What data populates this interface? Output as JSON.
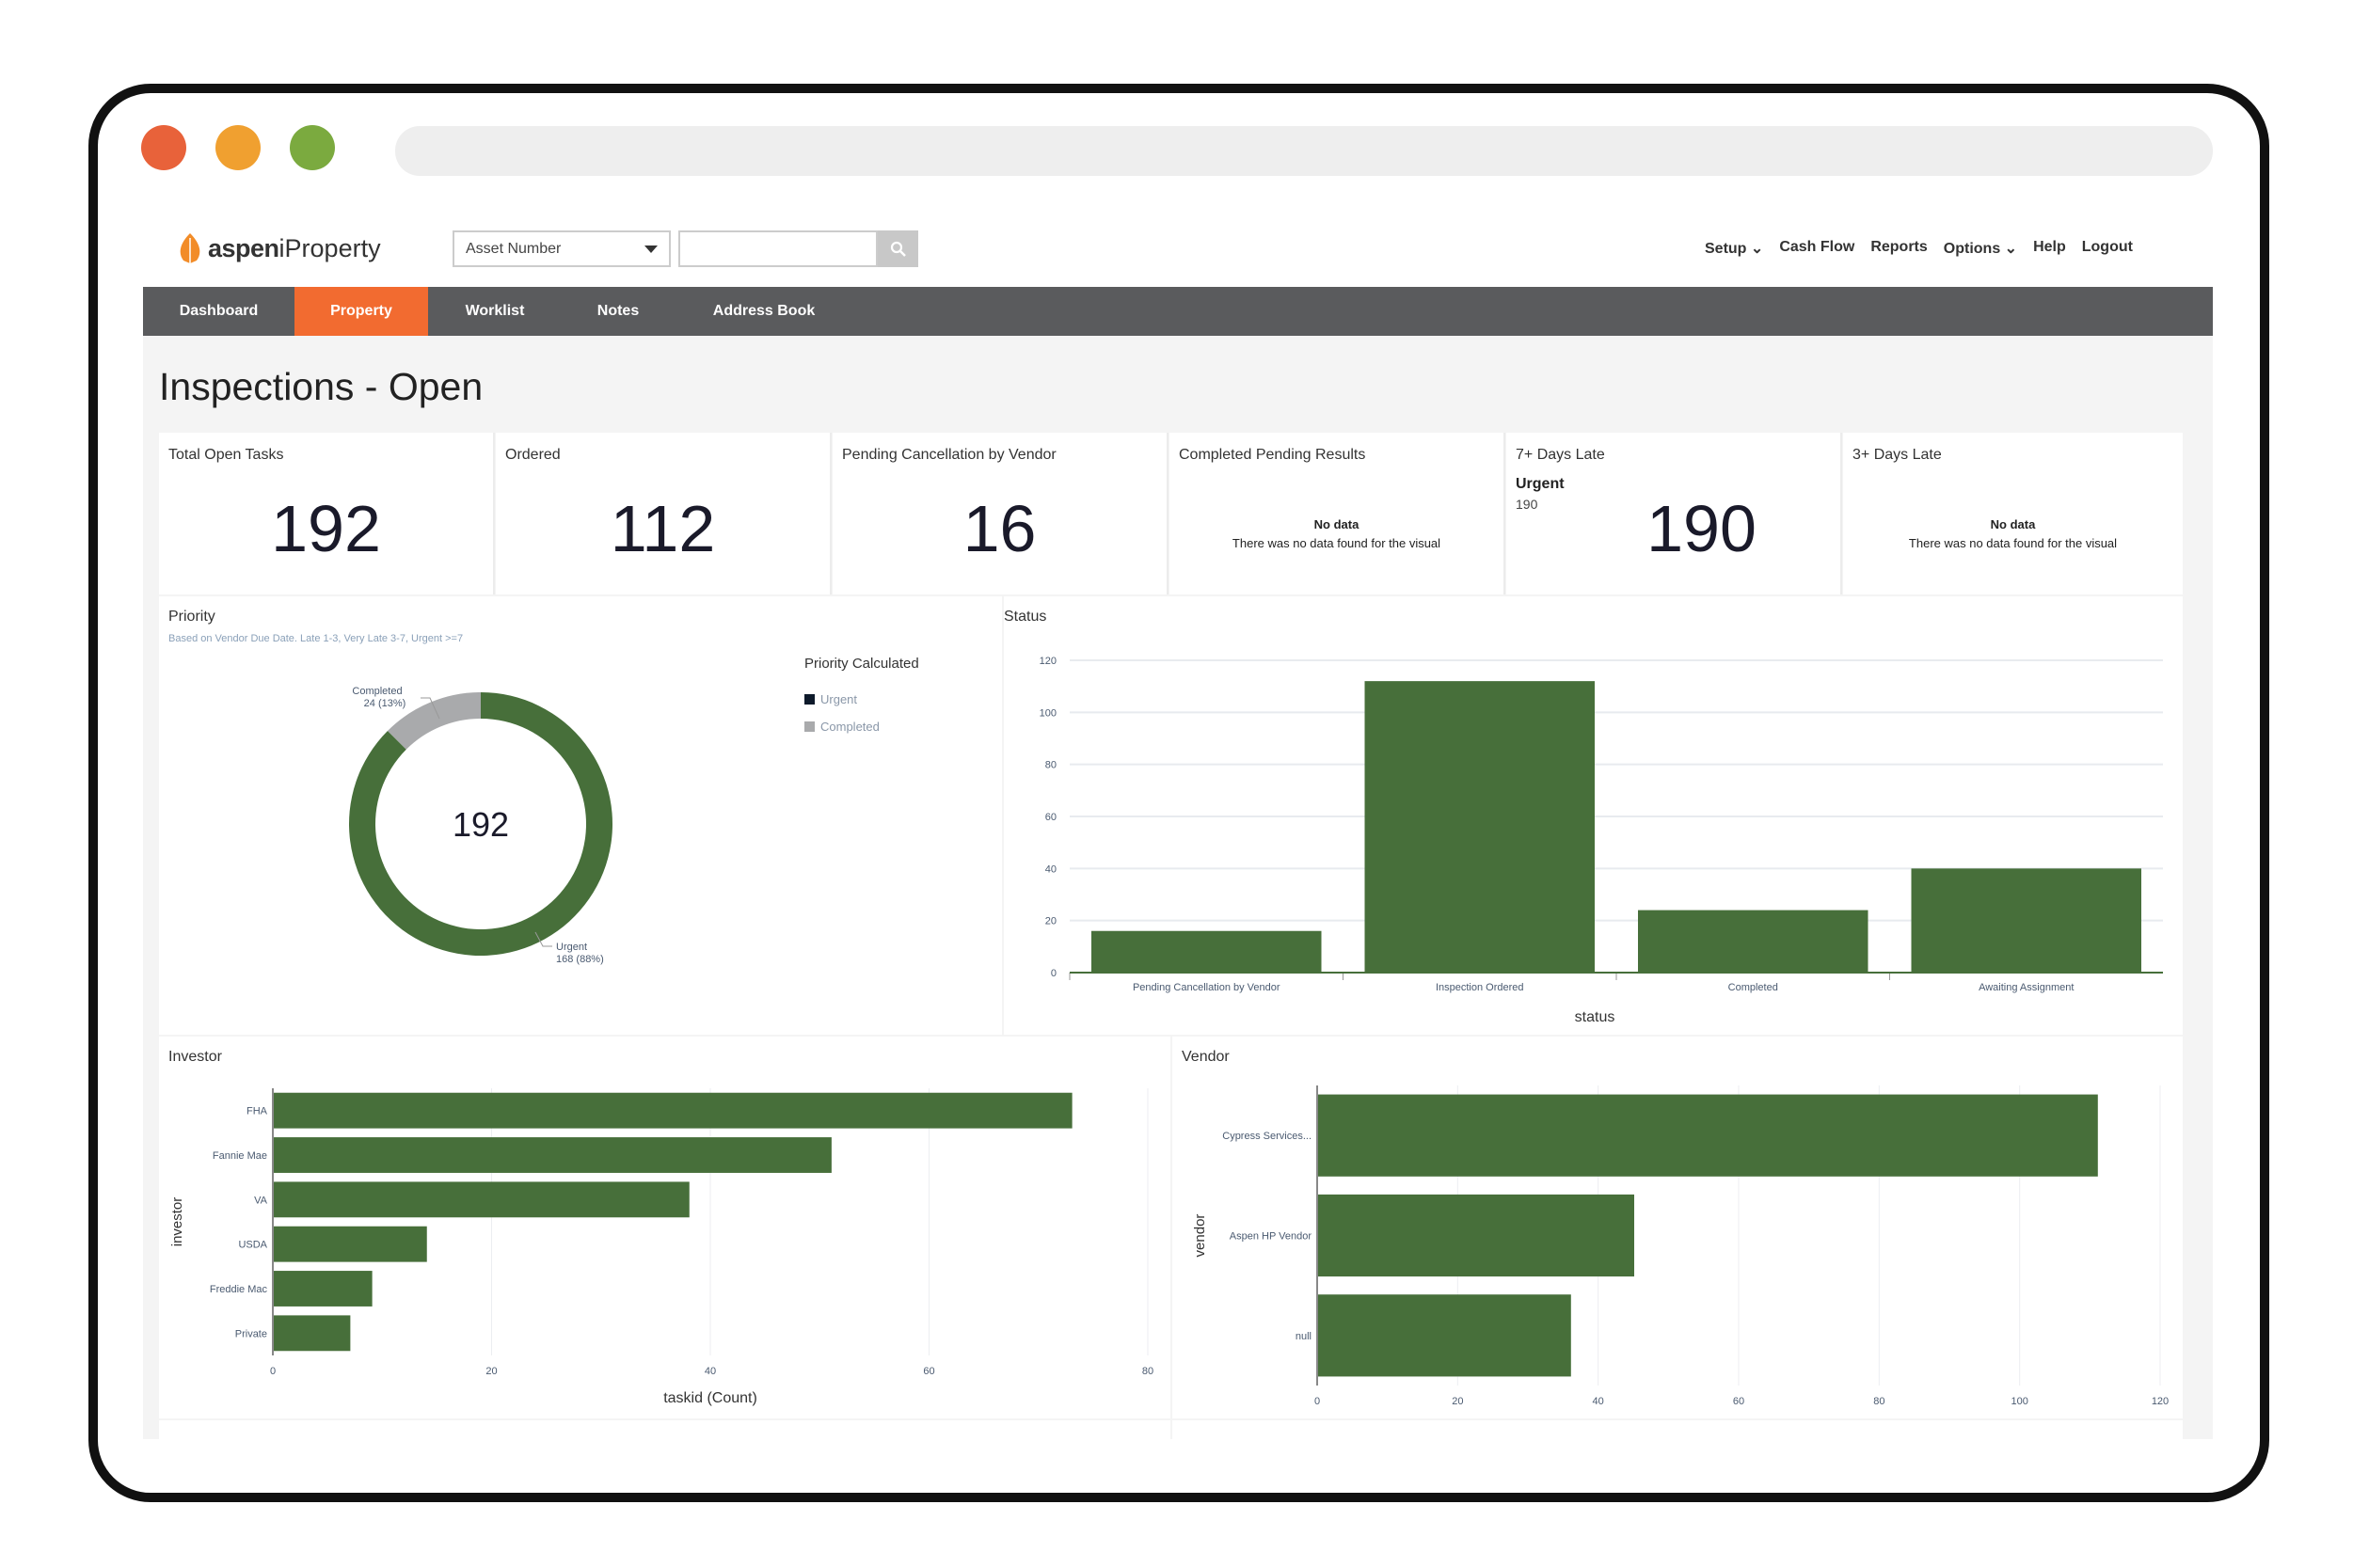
{
  "window": {
    "traffic_lights": [
      "#E8623A",
      "#F0A030",
      "#7BAA3F"
    ]
  },
  "header": {
    "logo_text_bold": "aspen",
    "logo_text": "iProperty",
    "search_select": "Asset Number",
    "search_value": "",
    "nav": [
      "Setup",
      "Cash Flow",
      "Reports",
      "Options",
      "Help",
      "Logout"
    ]
  },
  "navbar": {
    "tabs": [
      "Dashboard",
      "Property",
      "Worklist",
      "Notes",
      "Address Book"
    ],
    "active": "Property"
  },
  "page": {
    "title": "Inspections - Open"
  },
  "kpis": [
    {
      "label": "Total Open Tasks",
      "value": "192"
    },
    {
      "label": "Ordered",
      "value": "112"
    },
    {
      "label": "Pending Cancellation by Vendor",
      "value": "16"
    },
    {
      "label": "Completed Pending Results",
      "no_data": "No data",
      "no_data_msg": "There was no data found for the visual"
    },
    {
      "label": "7+ Days Late",
      "sub_label": "Urgent",
      "sub_value": "190",
      "value": "190"
    },
    {
      "label": "3+ Days Late",
      "no_data": "No data",
      "no_data_msg": "There was no data found for the visual"
    }
  ],
  "colors": {
    "bar": "#476F3A",
    "completed": "#A9AAAC",
    "accent": "#F26B30",
    "nav": "#5A5B5D"
  },
  "chart_data": [
    {
      "type": "pie",
      "title": "Priority",
      "subtitle": "Based on Vendor Due Date. Late 1-3, Very Late 3-7, Urgent >=7",
      "center_label": "192",
      "legend_title": "Priority Calculated",
      "legend_placement": "right",
      "slices": [
        {
          "name": "Urgent",
          "value": 168,
          "label": "168 (88%)",
          "color": "#476F3A",
          "legend_color": "#0E1A2B"
        },
        {
          "name": "Completed",
          "value": 24,
          "label": "24 (13%)",
          "color": "#A9AAAC"
        }
      ]
    },
    {
      "type": "bar",
      "title": "Status",
      "xlabel": "status",
      "ylabel": "",
      "ylim": [
        0,
        120
      ],
      "yticks": [
        0,
        20,
        40,
        60,
        80,
        100,
        120
      ],
      "grid": true,
      "categories": [
        "Pending Cancellation by Vendor",
        "Inspection Ordered",
        "Completed",
        "Awaiting Assignment"
      ],
      "values": [
        16,
        112,
        24,
        40
      ]
    },
    {
      "type": "bar",
      "orientation": "horizontal",
      "title": "Investor",
      "xlabel": "taskid (Count)",
      "ylabel": "investor",
      "xlim": [
        0,
        80
      ],
      "xticks": [
        0,
        20,
        40,
        60,
        80
      ],
      "grid": true,
      "categories": [
        "FHA",
        "Fannie Mae",
        "VA",
        "USDA",
        "Freddie Mac",
        "Private"
      ],
      "values": [
        73,
        51,
        38,
        14,
        9,
        7
      ]
    },
    {
      "type": "bar",
      "orientation": "horizontal",
      "title": "Vendor",
      "xlabel": "",
      "ylabel": "vendor",
      "xlim": [
        0,
        120
      ],
      "xticks": [
        0,
        20,
        40,
        60,
        80,
        100,
        120
      ],
      "grid": true,
      "categories": [
        "Cypress Services...",
        "Aspen HP Vendor",
        "null"
      ],
      "values": [
        111,
        45,
        36
      ]
    }
  ]
}
